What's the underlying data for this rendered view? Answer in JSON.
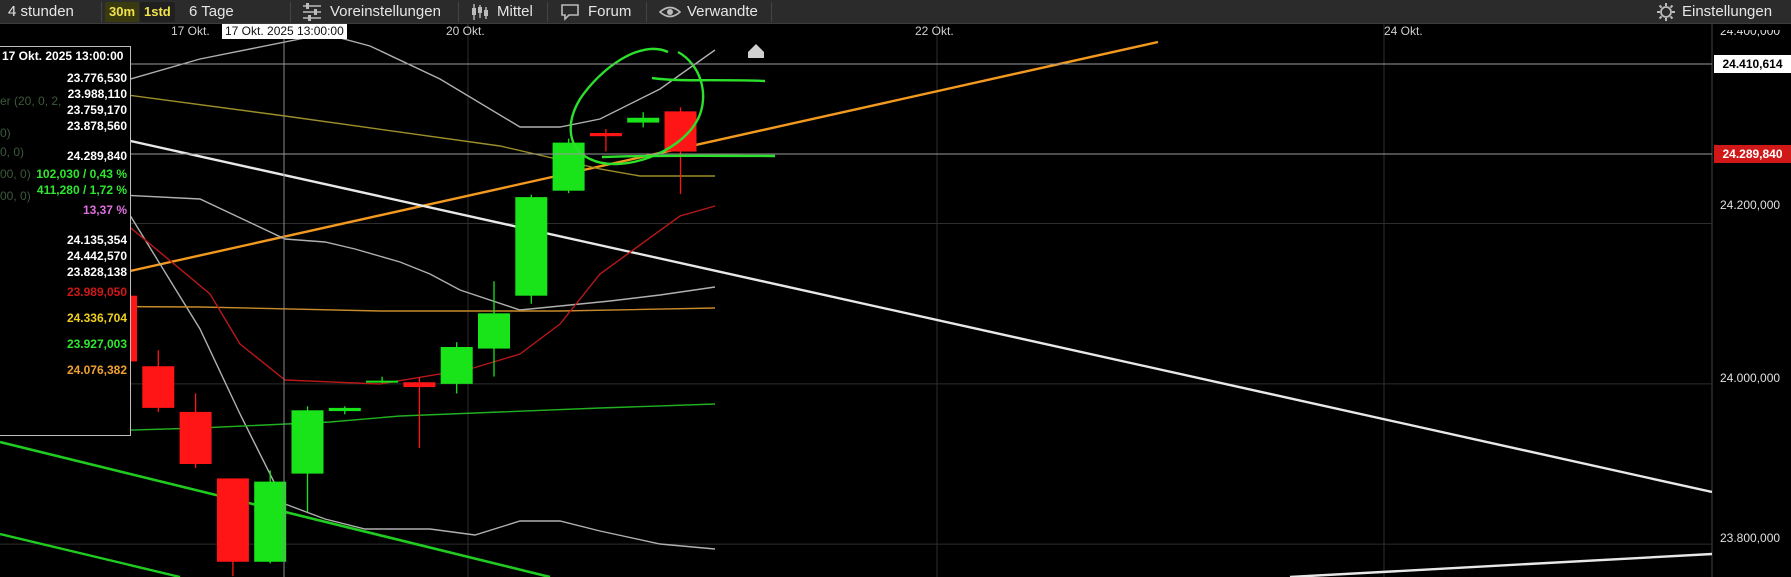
{
  "toolbar": {
    "range_label": "4 stunden",
    "intervals": [
      "30m",
      "1std"
    ],
    "period_label": "6 Tage",
    "presets_label": "Voreinstellungen",
    "indicator_label": "Mittel",
    "forum_label": "Forum",
    "related_label": "Verwandte",
    "settings_label": "Einstellungen"
  },
  "crosshair_label": "17 Okt. 2025 13:00:00",
  "info_panel": {
    "date": "17 Okt. 2025 13:00:00",
    "rows": [
      {
        "text": "23.776,530",
        "color": "#ffffff"
      },
      {
        "text": "23.988,110",
        "color": "#ffffff"
      },
      {
        "text": "23.759,170",
        "color": "#ffffff"
      },
      {
        "text": "23.878,560",
        "color": "#ffffff"
      },
      {
        "text": "24.289,840",
        "color": "#ffffff"
      },
      {
        "text": "102,030 / 0,43 %",
        "color": "#2ee82e"
      },
      {
        "text": "411,280 / 1,72 %",
        "color": "#2ee82e"
      },
      {
        "text": "13,37 %",
        "color": "#e070e0"
      },
      {
        "text": "24.135,354",
        "color": "#ffffff"
      },
      {
        "text": "24.442,570",
        "color": "#ffffff"
      },
      {
        "text": "23.828,138",
        "color": "#ffffff"
      },
      {
        "text": "23.989,050",
        "color": "#d01818"
      },
      {
        "text": "24.336,704",
        "color": "#f0d020"
      },
      {
        "text": "23.927,003",
        "color": "#2ee82e"
      },
      {
        "text": "24.076,382",
        "color": "#f0a030"
      }
    ],
    "ghost_texts": [
      "er (20, 0, 2,",
      "0)",
      "0, 0)",
      "00, 0)",
      "00, 0)"
    ]
  },
  "chart_data": {
    "type": "candlestick",
    "x_ticks": [
      "17 Okt.",
      "20 Okt.",
      "22 Okt.",
      "24 Okt."
    ],
    "y_ticks": [
      {
        "label": "24.200,000",
        "value": 24200
      },
      {
        "label": "24.000,000",
        "value": 24000
      },
      {
        "label": "23.800,000",
        "value": 23800
      }
    ],
    "y_top_partial_label": "24.400,000",
    "ylim": [
      23759,
      24449
    ],
    "price_flags": [
      {
        "label": "24.410,614",
        "value": 24410.614,
        "bg": "#ffffff",
        "fg": "#000000"
      },
      {
        "label": "24.289,840",
        "value": 24289.84,
        "bg": "#d01818",
        "fg": "#ffffff"
      }
    ],
    "candles": [
      {
        "open": 24110,
        "high": 24130,
        "low": 24025,
        "close": 24028
      },
      {
        "open": 24022,
        "high": 24042,
        "low": 23965,
        "close": 23970
      },
      {
        "open": 23965,
        "high": 23988,
        "low": 23895,
        "close": 23900
      },
      {
        "open": 23882,
        "high": 23882,
        "low": 23760,
        "close": 23778
      },
      {
        "open": 23778,
        "high": 23892,
        "low": 23776,
        "close": 23878
      },
      {
        "open": 23888,
        "high": 23972,
        "low": 23840,
        "close": 23967
      },
      {
        "open": 23966,
        "high": 23972,
        "low": 23962,
        "close": 23970
      },
      {
        "open": 24004,
        "high": 24009,
        "low": 24001,
        "close": 24004
      },
      {
        "open": 24002,
        "high": 24008,
        "low": 23920,
        "close": 23996
      },
      {
        "open": 24000,
        "high": 24052,
        "low": 23988,
        "close": 24046
      },
      {
        "open": 24044,
        "high": 24128,
        "low": 24009,
        "close": 24088
      },
      {
        "open": 24110,
        "high": 24236,
        "low": 24100,
        "close": 24233
      },
      {
        "open": 24241,
        "high": 24306,
        "low": 24238,
        "close": 24301
      },
      {
        "open": 24313,
        "high": 24318,
        "low": 24290,
        "close": 24309
      },
      {
        "open": 24326,
        "high": 24339,
        "low": 24320,
        "close": 24332
      },
      {
        "open": 24340,
        "high": 24345,
        "low": 24237,
        "close": 24289.84
      }
    ],
    "colors": {
      "up": "#19e319",
      "down": "#ff1515",
      "grid": "#2e2e2e"
    }
  }
}
